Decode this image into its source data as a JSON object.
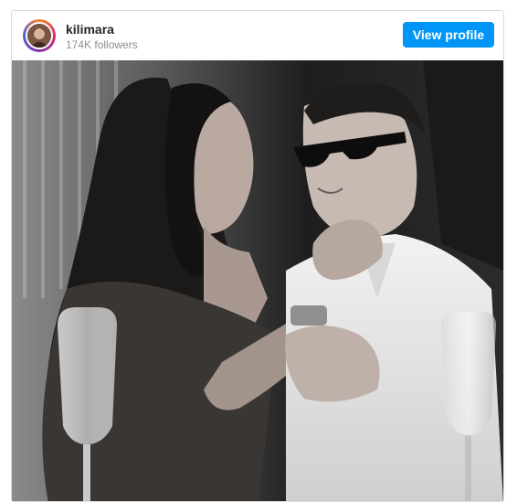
{
  "post": {
    "username": "kilimara",
    "followers": "174K followers",
    "view_profile_label": "View profile",
    "accent_color": "#0095f6",
    "photo_description_icon": "photo-image"
  }
}
